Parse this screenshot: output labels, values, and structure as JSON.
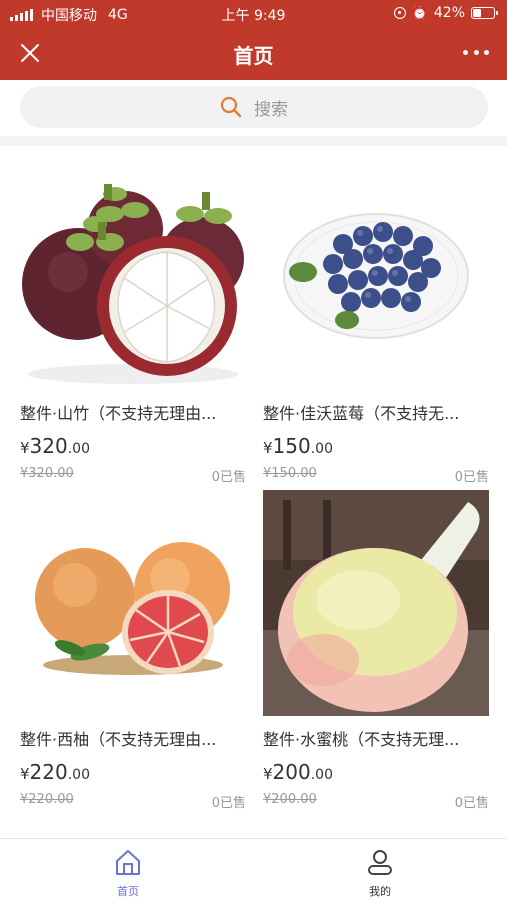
{
  "status_bar": {
    "carrier": "中国移动",
    "network": "4G",
    "time": "上午 9:49",
    "battery": "42%",
    "battery_level": 0.42
  },
  "navbar": {
    "title": "首页",
    "close_icon": "close-icon",
    "more_icon": "more-icon"
  },
  "search": {
    "placeholder": "搜索",
    "icon": "search-icon",
    "accent": "#e07b39"
  },
  "theme": {
    "header_bg": "#c0392b",
    "active_tab": "#6a72d6"
  },
  "products": [
    {
      "name": "整件·山竹（不支持无理由...",
      "currency": "¥",
      "price_int": "320",
      "price_dec": ".00",
      "original_price": "¥320.00",
      "sold": "0已售"
    },
    {
      "name": "整件·佳沃蓝莓（不支持无...",
      "currency": "¥",
      "price_int": "150",
      "price_dec": ".00",
      "original_price": "¥150.00",
      "sold": "0已售"
    },
    {
      "name": "整件·西柚（不支持无理由...",
      "currency": "¥",
      "price_int": "220",
      "price_dec": ".00",
      "original_price": "¥220.00",
      "sold": "0已售"
    },
    {
      "name": "整件·水蜜桃（不支持无理...",
      "currency": "¥",
      "price_int": "200",
      "price_dec": ".00",
      "original_price": "¥200.00",
      "sold": "0已售"
    }
  ],
  "tabbar": {
    "home": {
      "label": "首页",
      "icon": "home-icon"
    },
    "mine": {
      "label": "我的",
      "icon": "user-icon"
    }
  }
}
